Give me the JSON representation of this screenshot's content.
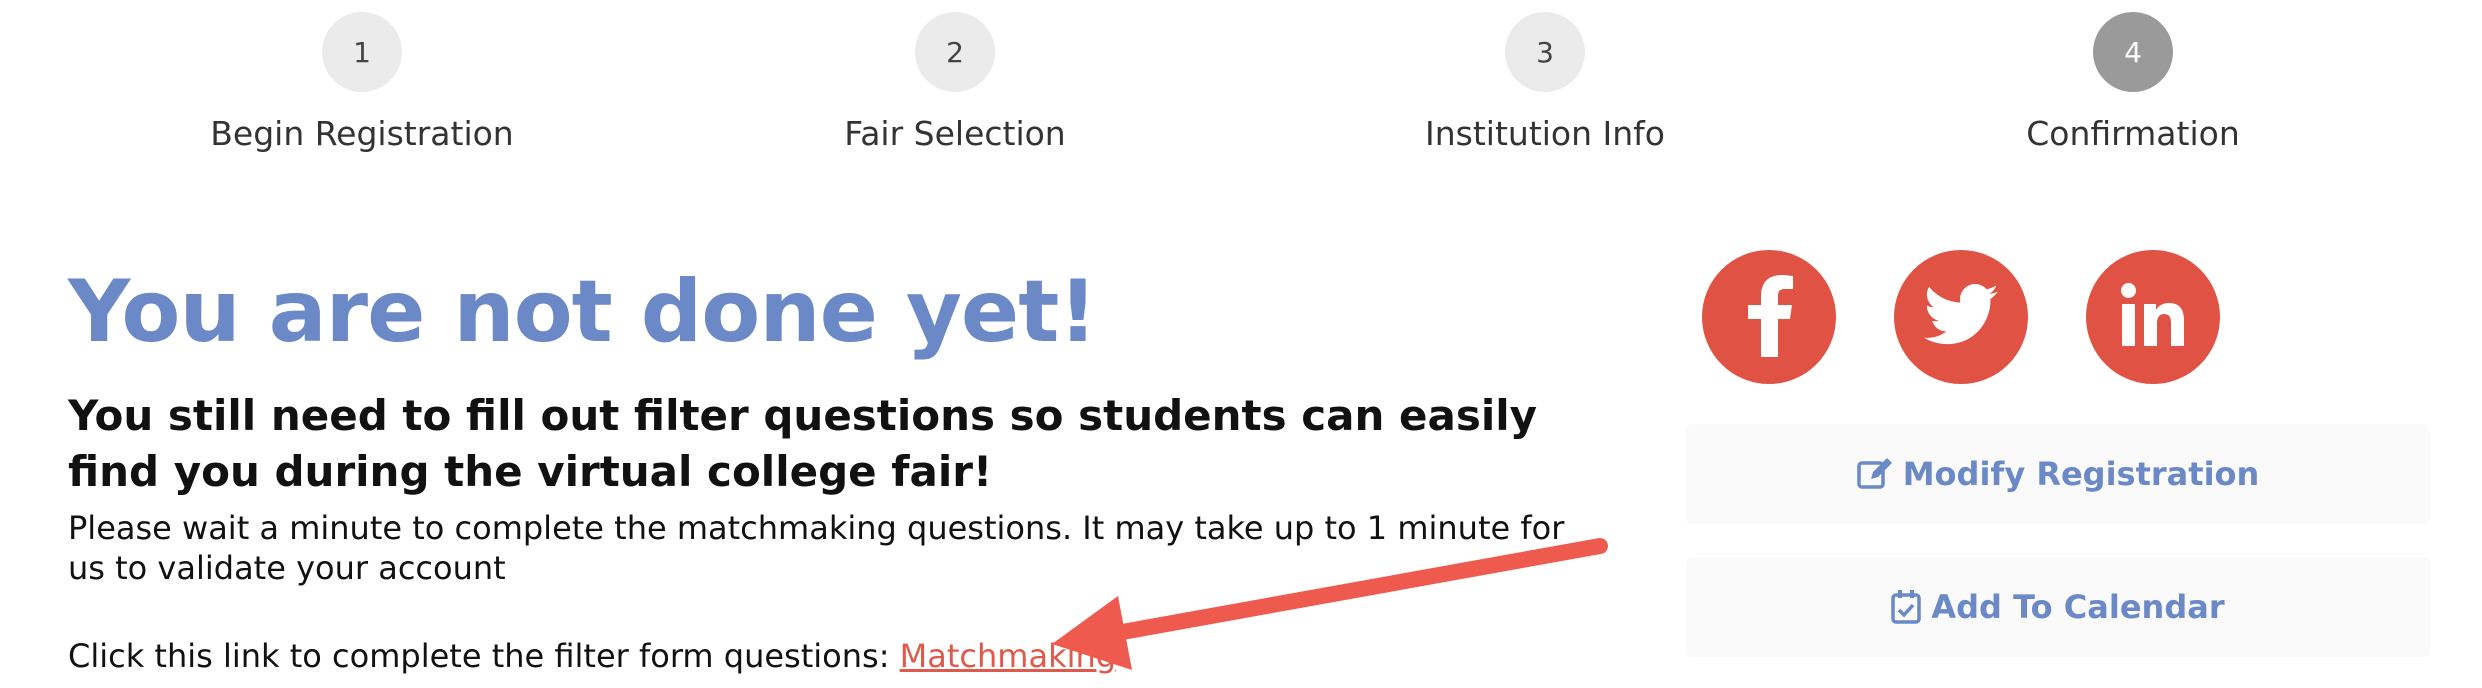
{
  "stepper": {
    "steps": [
      {
        "number": "1",
        "label": "Begin Registration"
      },
      {
        "number": "2",
        "label": "Fair Selection"
      },
      {
        "number": "3",
        "label": "Institution Info"
      },
      {
        "number": "4",
        "label": "Confirmation"
      }
    ],
    "active_step": "4"
  },
  "main": {
    "heading": "You are not done yet!",
    "subheading": "You still need to fill out filter questions so students can easily find you during the virtual college fair!",
    "body": "Please wait a minute to complete the matchmaking questions. It may take up to 1 minute for us to validate your account",
    "link_prefix": "Click this link to complete the filter form questions: ",
    "link_label": "Matchmaking"
  },
  "social": {
    "icons": [
      "facebook-icon",
      "twitter-icon",
      "linkedin-icon"
    ]
  },
  "actions": {
    "modify_label": "Modify Registration",
    "calendar_label": "Add To Calendar"
  },
  "colors": {
    "accent_blue": "#6b89c7",
    "social_red": "#e05244",
    "arrow_red": "#ef5a4e",
    "step_active": "#9a9a9a"
  }
}
